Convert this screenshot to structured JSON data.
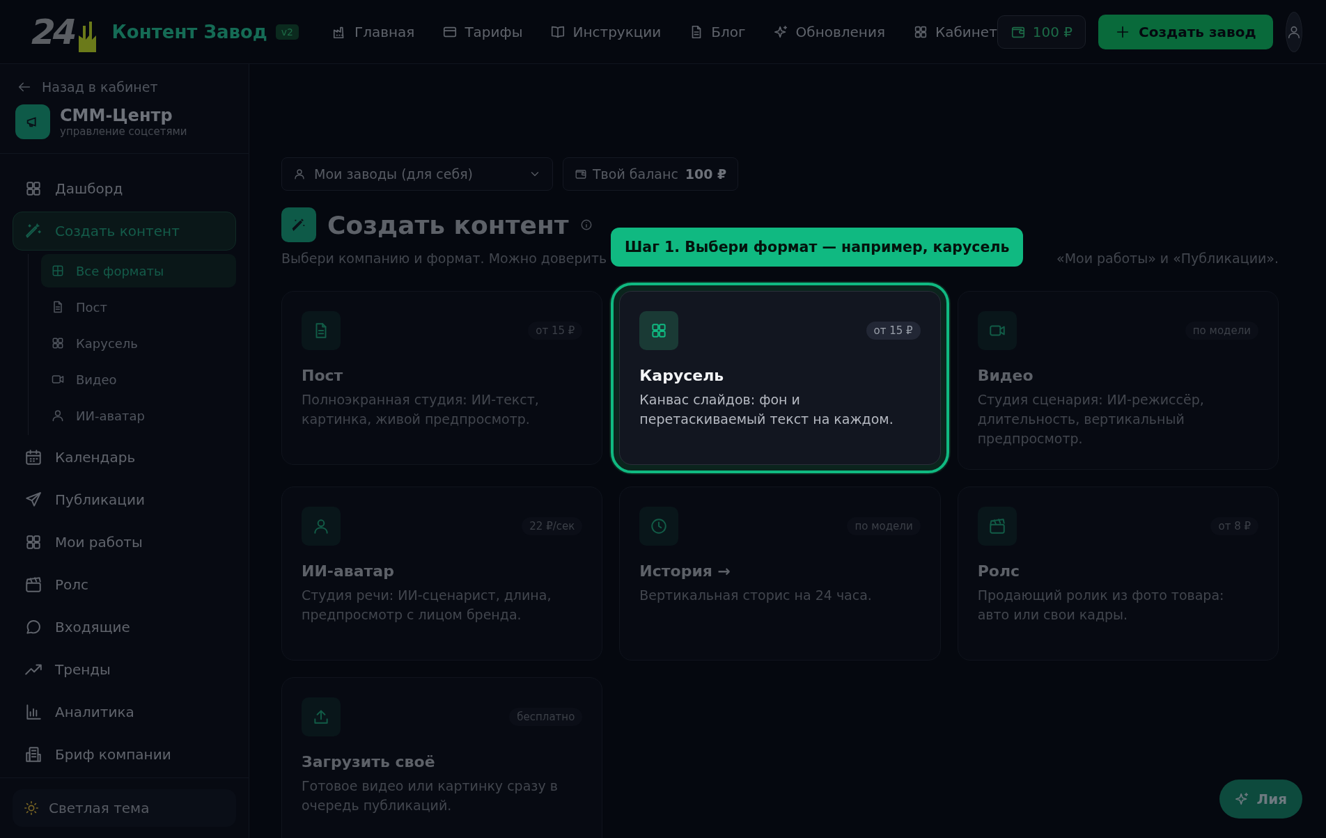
{
  "brand": {
    "logo": "24",
    "name": "Контент Завод",
    "version": "v2"
  },
  "nav": [
    {
      "label": "Главная"
    },
    {
      "label": "Тарифы"
    },
    {
      "label": "Инструкции"
    },
    {
      "label": "Блог"
    },
    {
      "label": "Обновления"
    },
    {
      "label": "Кабинет"
    }
  ],
  "top_balance": "100 ₽",
  "create_button": "Создать завод",
  "sidebar": {
    "back": "Назад в кабинет",
    "company": {
      "name": "СММ-Центр",
      "subtitle": "управление соцсетями"
    },
    "items": [
      {
        "label": "Дашборд",
        "selected": false
      },
      {
        "label": "Создать контент",
        "selected": true,
        "children": [
          {
            "label": "Все форматы",
            "selected": true
          },
          {
            "label": "Пост",
            "selected": false
          },
          {
            "label": "Карусель",
            "selected": false
          },
          {
            "label": "Видео",
            "selected": false
          },
          {
            "label": "ИИ-аватар",
            "selected": false
          }
        ]
      },
      {
        "label": "Календарь",
        "selected": false
      },
      {
        "label": "Публикации",
        "selected": false
      },
      {
        "label": "Мои работы",
        "selected": false
      },
      {
        "label": "Ролс",
        "selected": false
      },
      {
        "label": "Входящие",
        "selected": false
      },
      {
        "label": "Тренды",
        "selected": false
      },
      {
        "label": "Аналитика",
        "selected": false
      },
      {
        "label": "Бриф компании",
        "selected": false
      }
    ],
    "theme_toggle": "Светлая тема"
  },
  "main": {
    "factory_select": "Мои заводы (для себя)",
    "balance_label": "Твой баланс",
    "balance_value": "100 ₽",
    "title": "Создать контент",
    "subtitle_start": "Выбери компанию и формат. Можно доверить",
    "subtitle_end": "«Мои работы» и «Публикации».",
    "tooltip": "Шаг 1. Выбери формат — например, карусель",
    "cards": [
      {
        "price": "от 15 ₽",
        "title": "Пост",
        "description": "Полноэкранная студия: ИИ-текст, картинка, живой предпросмотр.",
        "highlighted": false
      },
      {
        "price": "от 15 ₽",
        "title": "Карусель",
        "description": "Канвас слайдов: фон и перетаскиваемый текст на каждом.",
        "highlighted": true
      },
      {
        "price": "по модели",
        "title": "Видео",
        "description": "Студия сценария: ИИ-режиссёр, длительность, вертикальный предпросмотр.",
        "highlighted": false
      },
      {
        "price": "22 ₽/сек",
        "title": "ИИ-аватар",
        "description": "Студия речи: ИИ-сценарист, длина, предпросмотр с лицом бренда.",
        "highlighted": false
      },
      {
        "price": "по модели",
        "title": "История →",
        "description": "Вертикальная сторис на 24 часа.",
        "highlighted": false
      },
      {
        "price": "от 8 ₽",
        "title": "Ролс",
        "description": "Продающий ролик из фото товара: авто или свои кадры.",
        "highlighted": false
      },
      {
        "price": "бесплатно",
        "title": "Загрузить своё",
        "description": "Готовое видео или картинку сразу в очередь публикаций.",
        "highlighted": false
      }
    ]
  },
  "assistant_button": "Лия"
}
